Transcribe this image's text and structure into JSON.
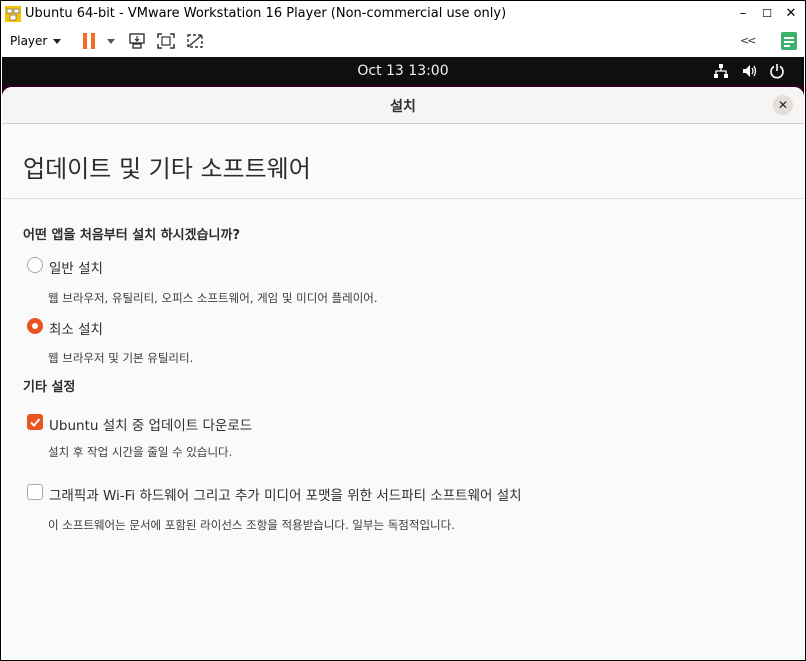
{
  "vmware": {
    "window_title": "Ubuntu 64-bit - VMware Workstation 16 Player (Non-commercial use only)",
    "controls": {
      "minimize": "–",
      "maximize": "☐",
      "close": "✕"
    },
    "toolbar": {
      "player_label": "Player",
      "collapse_label": "<<"
    },
    "accent_color": "#f26b21"
  },
  "ubuntu_topbar": {
    "clock": "Oct 13  13:00",
    "icons": [
      "network-icon",
      "volume-icon",
      "power-icon"
    ]
  },
  "installer": {
    "window_title": "설치",
    "close_symbol": "✕",
    "page_title": "업데이트 및 기타 소프트웨어",
    "question": "어떤 앱을 처음부터 설치 하시겠습니까?",
    "options": [
      {
        "label": "일반 설치",
        "description": "웹 브라우저, 유틸리티, 오피스  소프트웨어, 게임 및 미디어 플레이어.",
        "selected": false
      },
      {
        "label": "최소 설치",
        "description": "웹 브라우저 및 기본 유틸리티.",
        "selected": true
      }
    ],
    "other_section": "기타 설정",
    "checks": [
      {
        "label": "Ubuntu 설치 중 업데이트 다운로드",
        "description": "설치 후 작업 시간을 줄일 수 있습니다.",
        "checked": true
      },
      {
        "label": "그래픽과 Wi-Fi 하드웨어 그리고 추가 미디어 포맷을 위한 서드파티 소프트웨어 설치",
        "description": "이 소프트웨어는 문서에 포함된 라이선스 조항을 적용받습니다. 일부는 독점적입니다.",
        "checked": false
      }
    ],
    "accent_color": "#e95420"
  }
}
